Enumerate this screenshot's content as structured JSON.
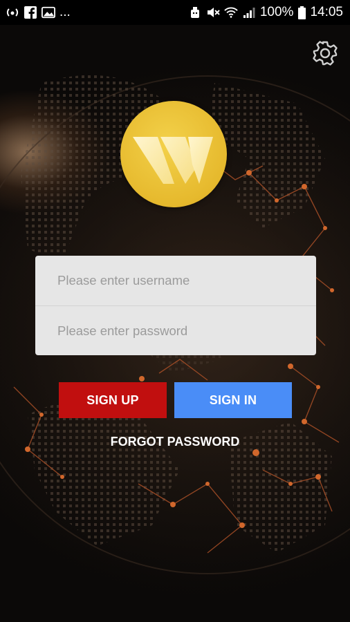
{
  "status_bar": {
    "left_icons": [
      "hotspot-icon",
      "facebook-icon",
      "image-notification-icon"
    ],
    "more_notifications": "...",
    "right_icons": [
      "android-debug-icon",
      "mute-icon",
      "wifi-icon",
      "signal-icon",
      "battery-icon"
    ],
    "battery_percent": "100%",
    "time": "14:05"
  },
  "settings": {
    "icon": "gear-icon"
  },
  "logo": {
    "brand_color": "#E6B92D",
    "letter": "W"
  },
  "login_form": {
    "username_placeholder": "Please enter username",
    "password_placeholder": "Please enter password"
  },
  "buttons": {
    "sign_up_label": "SIGN UP",
    "sign_in_label": "SIGN IN",
    "sign_up_color": "#C10F0F",
    "sign_in_color": "#4A8DF7"
  },
  "forgot_password_label": "FORGOT PASSWORD"
}
